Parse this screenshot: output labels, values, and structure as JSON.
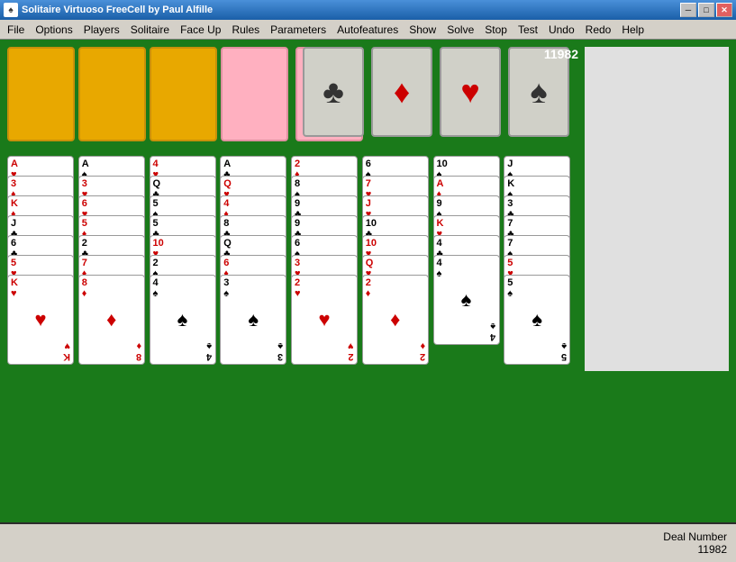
{
  "title_bar": {
    "icon": "♠",
    "title": "Solitaire Virtuoso    FreeCell    by Paul Alfille",
    "minimize": "─",
    "maximize": "□",
    "close": "✕"
  },
  "menu": {
    "items": [
      "File",
      "Options",
      "Players",
      "Solitaire",
      "Face Up",
      "Rules",
      "Parameters",
      "Autofeatures",
      "Show",
      "Solve",
      "Stop",
      "Test",
      "Undo",
      "Redo",
      "Help"
    ]
  },
  "score": "11982",
  "deal_number_label": "Deal Number",
  "deal_number": "11982",
  "foundations": [
    {
      "suit": "♣",
      "color": "black"
    },
    {
      "suit": "♦",
      "color": "red"
    },
    {
      "suit": "♥",
      "color": "red"
    },
    {
      "suit": "♠",
      "color": "black"
    }
  ],
  "columns": [
    {
      "id": "col1",
      "cards": [
        {
          "rank": "A",
          "suit": "♥",
          "color": "red",
          "offset": 0
        },
        {
          "rank": "3",
          "suit": "♦",
          "color": "red",
          "offset": 22
        },
        {
          "rank": "K",
          "suit": "♦",
          "color": "red",
          "offset": 44
        },
        {
          "rank": "J",
          "suit": "♣",
          "color": "black",
          "offset": 66
        },
        {
          "rank": "6",
          "suit": "♣",
          "color": "black",
          "offset": 88
        },
        {
          "rank": "5",
          "suit": "♥",
          "color": "red",
          "offset": 110
        },
        {
          "rank": "K",
          "suit": "♥",
          "color": "red",
          "offset": 132
        }
      ]
    },
    {
      "id": "col2",
      "cards": [
        {
          "rank": "A",
          "suit": "♠",
          "color": "black",
          "offset": 0
        },
        {
          "rank": "3",
          "suit": "♥",
          "color": "red",
          "offset": 22
        },
        {
          "rank": "6",
          "suit": "♥",
          "color": "red",
          "offset": 44
        },
        {
          "rank": "5",
          "suit": "♦",
          "color": "red",
          "offset": 66
        },
        {
          "rank": "2",
          "suit": "♣",
          "color": "black",
          "offset": 88
        },
        {
          "rank": "7",
          "suit": "♦",
          "color": "red",
          "offset": 110
        },
        {
          "rank": "8",
          "suit": "♦",
          "color": "red",
          "offset": 132
        }
      ]
    },
    {
      "id": "col3",
      "cards": [
        {
          "rank": "4",
          "suit": "♥",
          "color": "red",
          "offset": 0
        },
        {
          "rank": "Q",
          "suit": "♣",
          "color": "black",
          "offset": 22
        },
        {
          "rank": "5",
          "suit": "♠",
          "color": "black",
          "offset": 44
        },
        {
          "rank": "5",
          "suit": "♣",
          "color": "black",
          "offset": 66
        },
        {
          "rank": "10",
          "suit": "♥",
          "color": "red",
          "offset": 88
        },
        {
          "rank": "2",
          "suit": "♠",
          "color": "black",
          "offset": 110
        },
        {
          "rank": "4",
          "suit": "♠",
          "color": "black",
          "offset": 132
        }
      ]
    },
    {
      "id": "col4",
      "cards": [
        {
          "rank": "A",
          "suit": "♣",
          "color": "black",
          "offset": 0
        },
        {
          "rank": "Q",
          "suit": "♥",
          "color": "red",
          "offset": 22
        },
        {
          "rank": "4",
          "suit": "♦",
          "color": "red",
          "offset": 44
        },
        {
          "rank": "8",
          "suit": "♣",
          "color": "black",
          "offset": 66
        },
        {
          "rank": "Q",
          "suit": "♣",
          "color": "black",
          "offset": 88
        },
        {
          "rank": "6",
          "suit": "♦",
          "color": "red",
          "offset": 110
        },
        {
          "rank": "3",
          "suit": "♠",
          "color": "black",
          "offset": 132
        }
      ]
    },
    {
      "id": "col5",
      "cards": [
        {
          "rank": "2",
          "suit": "♦",
          "color": "red",
          "offset": 0
        },
        {
          "rank": "8",
          "suit": "♠",
          "color": "black",
          "offset": 22
        },
        {
          "rank": "9",
          "suit": "♣",
          "color": "black",
          "offset": 44
        },
        {
          "rank": "9",
          "suit": "♣",
          "color": "black",
          "offset": 66
        },
        {
          "rank": "6",
          "suit": "♠",
          "color": "black",
          "offset": 88
        },
        {
          "rank": "3",
          "suit": "♥",
          "color": "red",
          "offset": 110
        },
        {
          "rank": "2",
          "suit": "♥",
          "color": "red",
          "offset": 132
        }
      ]
    },
    {
      "id": "col6",
      "cards": [
        {
          "rank": "6",
          "suit": "♠",
          "color": "black",
          "offset": 0
        },
        {
          "rank": "7",
          "suit": "♥",
          "color": "red",
          "offset": 22
        },
        {
          "rank": "J",
          "suit": "♥",
          "color": "red",
          "offset": 44
        },
        {
          "rank": "10",
          "suit": "♣",
          "color": "black",
          "offset": 66
        },
        {
          "rank": "10",
          "suit": "♥",
          "color": "red",
          "offset": 88
        },
        {
          "rank": "Q",
          "suit": "♥",
          "color": "red",
          "offset": 110
        },
        {
          "rank": "2",
          "suit": "♦",
          "color": "red",
          "offset": 132
        }
      ]
    },
    {
      "id": "col7",
      "cards": [
        {
          "rank": "10",
          "suit": "♠",
          "color": "black",
          "offset": 0
        },
        {
          "rank": "A",
          "suit": "♦",
          "color": "red",
          "offset": 22
        },
        {
          "rank": "9",
          "suit": "♠",
          "color": "black",
          "offset": 44
        },
        {
          "rank": "K",
          "suit": "♥",
          "color": "red",
          "offset": 66
        },
        {
          "rank": "4",
          "suit": "♣",
          "color": "black",
          "offset": 88
        },
        {
          "rank": "4",
          "suit": "♠",
          "color": "black",
          "offset": 110
        }
      ]
    },
    {
      "id": "col8",
      "cards": [
        {
          "rank": "J",
          "suit": "♠",
          "color": "black",
          "offset": 0
        },
        {
          "rank": "K",
          "suit": "♠",
          "color": "black",
          "offset": 22
        },
        {
          "rank": "3",
          "suit": "♣",
          "color": "black",
          "offset": 44
        },
        {
          "rank": "7",
          "suit": "♣",
          "color": "black",
          "offset": 66
        },
        {
          "rank": "7",
          "suit": "♠",
          "color": "black",
          "offset": 88
        },
        {
          "rank": "5",
          "suit": "♥",
          "color": "red",
          "offset": 110
        },
        {
          "rank": "5",
          "suit": "♠",
          "color": "black",
          "offset": 132
        }
      ]
    }
  ]
}
